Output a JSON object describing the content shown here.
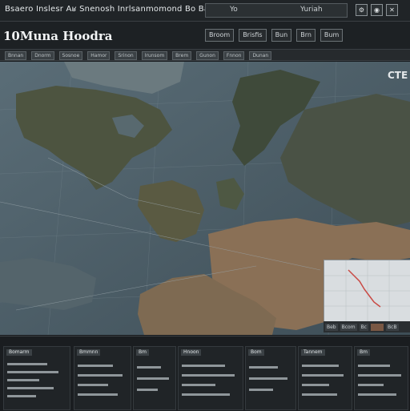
{
  "topbar": {
    "title": "Bsaero Inslesr Aʁ Snenosh Inrlsanmomond",
    "title_tail": "Bo Baur",
    "search_text": "Yo",
    "search_right": "Yuriah",
    "icons": [
      "settings-icon",
      "user-icon",
      "close-icon"
    ]
  },
  "header": {
    "title": "10Muna Hoodra",
    "chips": [
      "Broom",
      "Brisfis",
      "Bun",
      "Brn",
      "Bum"
    ]
  },
  "toolbar": {
    "items": [
      "Bnnan",
      "Dnorm",
      "Sosnoe",
      "Hamor",
      "Srinon",
      "Irunsom",
      "Brem",
      "Gunon",
      "Fnnon",
      "Dunan"
    ]
  },
  "map": {
    "corner_label": "CTE",
    "inset_bar": [
      "Beb",
      "Bcom",
      "Bc"
    ],
    "inset_bar_right": "BcB"
  },
  "bottom": {
    "panels": [
      {
        "label": "Bomarm"
      },
      {
        "label": "Bmmnn"
      },
      {
        "label": "Bm"
      },
      {
        "label": "Hnoon"
      },
      {
        "label": "Bom"
      },
      {
        "label": "Tannem"
      },
      {
        "label": "Bm"
      }
    ]
  },
  "colors": {
    "background": "#16191c",
    "ocean": "#4a5a63",
    "land_dark": "#3f4a3a",
    "land_tan": "#8a7056",
    "accent_red": "#c94a45"
  }
}
